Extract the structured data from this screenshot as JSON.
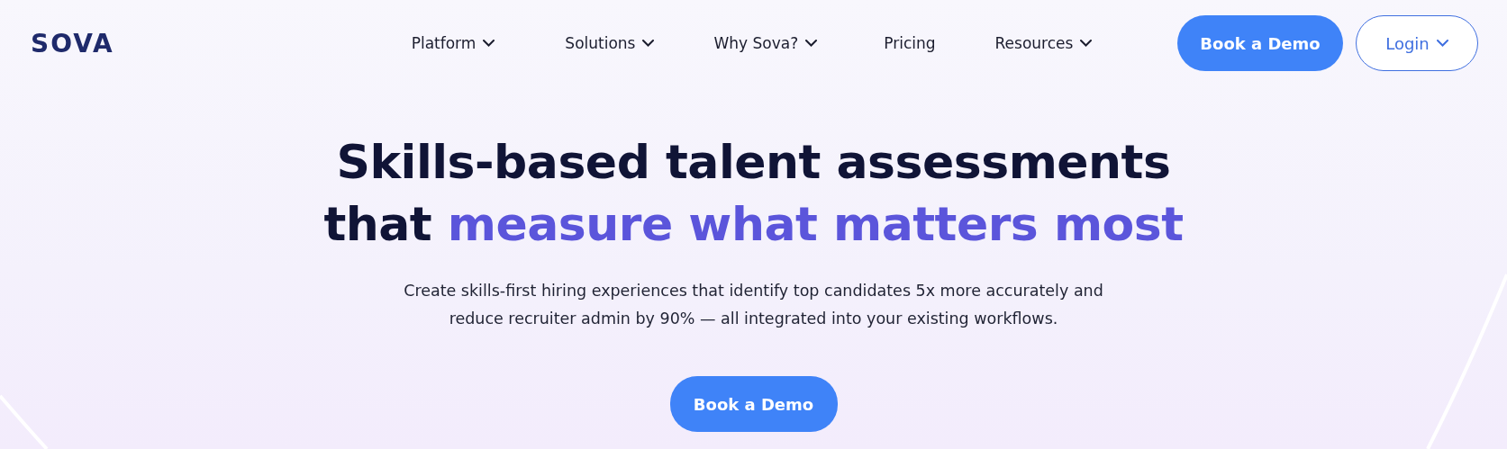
{
  "logo": "SOVA",
  "nav": [
    {
      "label": "Platform",
      "dropdown": true
    },
    {
      "label": "Solutions",
      "dropdown": true
    },
    {
      "label": "Why Sova?",
      "dropdown": true
    },
    {
      "label": "Pricing",
      "dropdown": false
    },
    {
      "label": "Resources",
      "dropdown": true
    }
  ],
  "actions": [
    {
      "kind": "primary",
      "label": "Book a Demo",
      "dropdown": false
    },
    {
      "kind": "outline",
      "label": "Login",
      "dropdown": true
    }
  ],
  "hero": {
    "headline": "Skills-based talent assessments",
    "headline_lead": "that",
    "headline_accent": "measure what matters most",
    "subtitle": [
      "Create skills-first hiring experiences that identify top candidates 5x more accurately and",
      "reduce recruiter admin by 90% — all integrated into your existing workflows."
    ],
    "cta": "Book a Demo"
  }
}
